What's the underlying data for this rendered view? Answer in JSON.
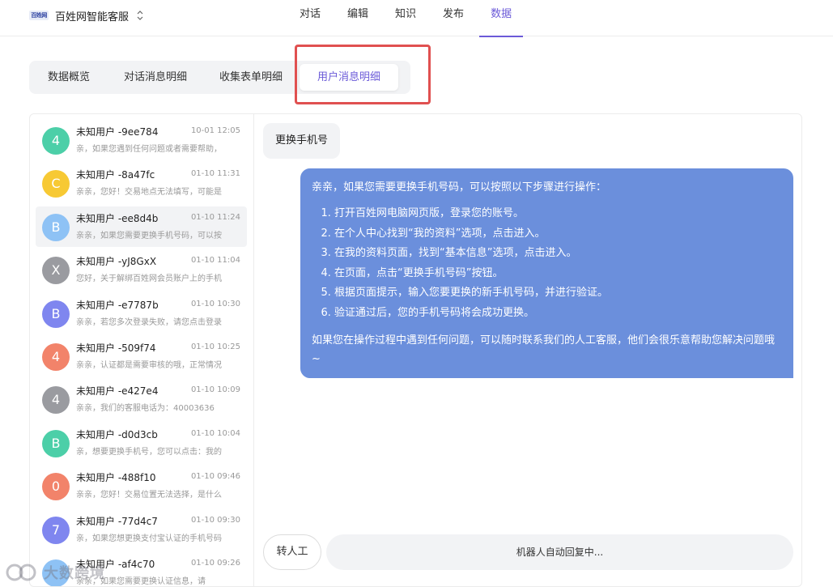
{
  "header": {
    "logo_text": "百姓网",
    "app_title": "百姓网智能客服",
    "nav": [
      {
        "label": "对话",
        "active": false
      },
      {
        "label": "编辑",
        "active": false
      },
      {
        "label": "知识",
        "active": false
      },
      {
        "label": "发布",
        "active": false
      },
      {
        "label": "数据",
        "active": true
      }
    ]
  },
  "subtabs": [
    {
      "label": "数据概览",
      "active": false
    },
    {
      "label": "对话消息明细",
      "active": false
    },
    {
      "label": "收集表单明细",
      "active": false
    },
    {
      "label": "用户消息明细",
      "active": true
    }
  ],
  "conversations": [
    {
      "avatar": "4",
      "color": "#4ccfa8",
      "name": "未知用户 -9ee784",
      "time": "10-01 12:05",
      "preview": "亲，如果您遇到任何问题或者需要帮助，",
      "selected": false
    },
    {
      "avatar": "C",
      "color": "#f7c934",
      "name": "未知用户 -8a47fc",
      "time": "01-10 11:31",
      "preview": "亲亲，您好！交易地点无法填写，可能是",
      "selected": false
    },
    {
      "avatar": "B",
      "color": "#8ec2f5",
      "name": "未知用户 -ee8d4b",
      "time": "01-10 11:24",
      "preview": "亲亲，如果您需要更换手机号码，可以按",
      "selected": true
    },
    {
      "avatar": "X",
      "color": "#9a9ba0",
      "name": "未知用户 -yJ8GxX",
      "time": "01-10 11:04",
      "preview": "您好，关于解绑百姓网会员账户上的手机",
      "selected": false
    },
    {
      "avatar": "B",
      "color": "#7f86ef",
      "name": "未知用户 -e7787b",
      "time": "01-10 10:30",
      "preview": "亲亲，若您多次登录失败，请您点击登录",
      "selected": false
    },
    {
      "avatar": "4",
      "color": "#f2836a",
      "name": "未知用户 -509f74",
      "time": "01-10 10:25",
      "preview": "亲亲，认证都是需要审核的哦，正常情况",
      "selected": false
    },
    {
      "avatar": "4",
      "color": "#9a9ba0",
      "name": "未知用户 -e427e4",
      "time": "01-10 10:09",
      "preview": "亲亲，我们的客服电话为：40003636",
      "selected": false
    },
    {
      "avatar": "B",
      "color": "#4ccfa8",
      "name": "未知用户 -d0d3cb",
      "time": "01-10 10:04",
      "preview": "亲，想要更换手机号，您可以点击：我的",
      "selected": false
    },
    {
      "avatar": "0",
      "color": "#f2836a",
      "name": "未知用户 -488f10",
      "time": "01-10 09:46",
      "preview": "亲亲，您好！交易位置无法选择，是什么",
      "selected": false
    },
    {
      "avatar": "7",
      "color": "#7f86ef",
      "name": "未知用户 -77d4c7",
      "time": "01-10 09:30",
      "preview": "亲，如果您想更换支付宝认证的手机号码",
      "selected": false
    },
    {
      "avatar": "",
      "color": "#8ec2f5",
      "name": "未知用户 -af4c70",
      "time": "01-10 09:26",
      "preview": "亲亲，如果您需要更换认证信息，请",
      "selected": false
    }
  ],
  "chat": {
    "user_message": "更换手机号",
    "bot_intro": "亲亲，如果您需要更换手机号码，可以按照以下步骤进行操作：",
    "bot_steps": [
      "打开百姓网电脑网页版，登录您的账号。",
      "在个人中心找到“我的资料”选项，点击进入。",
      "在我的资料页面，找到“基本信息”选项，点击进入。",
      "在页面，点击“更换手机号码”按钮。",
      "根据页面提示，输入您要更换的新手机号码，并进行验证。",
      "验证通过后，您的手机号码将会成功更换。"
    ],
    "bot_outro": "如果您在操作过程中遇到任何问题，可以随时联系我们的人工客服，他们会很乐意帮助您解决问题哦~",
    "handoff_label": "转人工",
    "auto_reply_label": "机器人自动回复中..."
  },
  "watermark": "大数跨境",
  "colors": {
    "accent": "#6b5ad8",
    "bot_bubble": "#6b8fdc",
    "highlight": "#e05050"
  }
}
